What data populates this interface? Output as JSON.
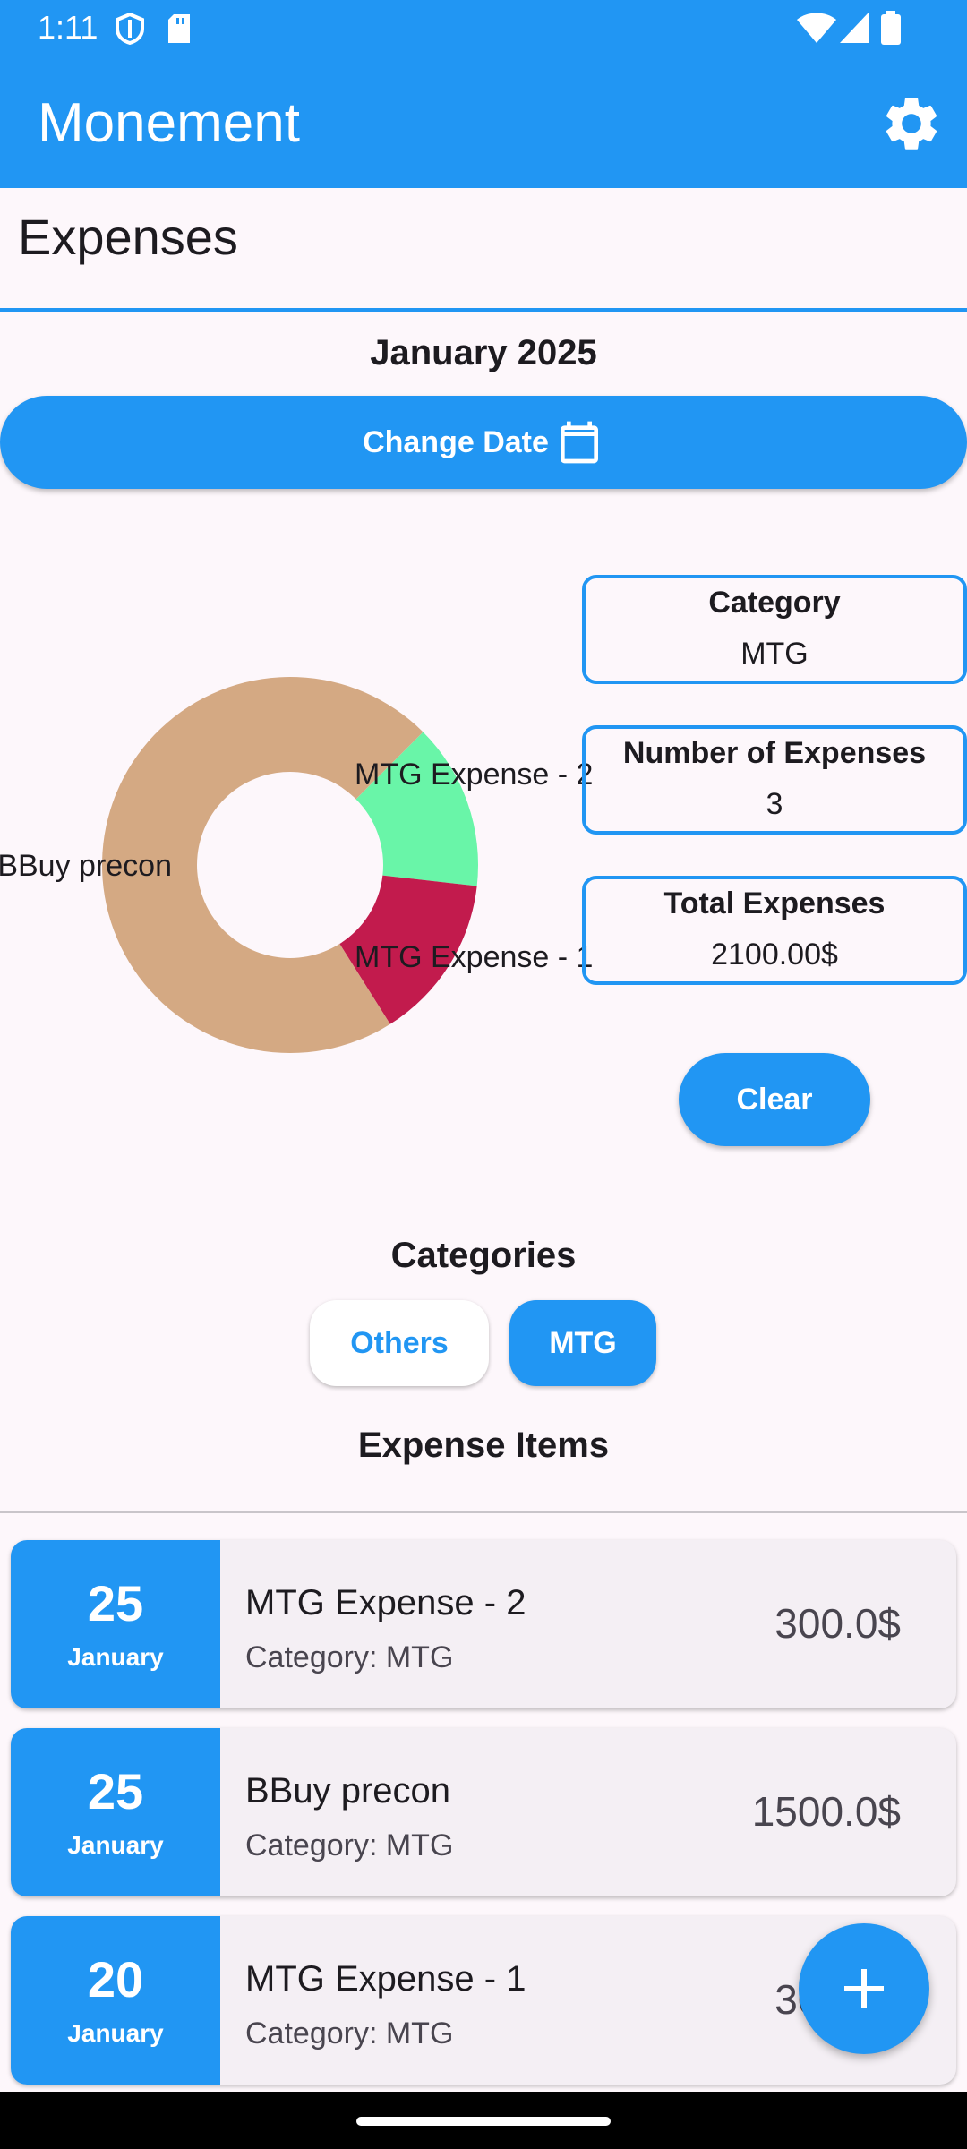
{
  "status_bar": {
    "time": "1:11"
  },
  "app_bar": {
    "title": "Monement"
  },
  "section": {
    "title": "Expenses"
  },
  "date_picker": {
    "month_label": "January 2025",
    "change_date_label": "Change Date"
  },
  "chart_data": {
    "type": "pie",
    "donut": true,
    "slices": [
      {
        "label": "MTG Expense - 2",
        "value": 300,
        "color": "#69f5a8"
      },
      {
        "label": "MTG Expense - 1",
        "value": 300,
        "color": "#c21b4d"
      },
      {
        "label": "BBuy precon",
        "value": 1500,
        "color": "#d4a983"
      }
    ]
  },
  "summary": {
    "category_label": "Category",
    "category_value": "MTG",
    "count_label": "Number of Expenses",
    "count_value": "3",
    "total_label": "Total Expenses",
    "total_value": "2100.00$",
    "clear_label": "Clear"
  },
  "categories": {
    "title": "Categories",
    "chips": [
      {
        "label": "Others",
        "selected": false
      },
      {
        "label": "MTG",
        "selected": true
      }
    ]
  },
  "expense_items": {
    "title": "Expense Items",
    "items": [
      {
        "day": "25",
        "month": "January",
        "name": "MTG Expense - 2",
        "category": "Category: MTG",
        "amount": "300.0$"
      },
      {
        "day": "25",
        "month": "January",
        "name": "BBuy precon",
        "category": "Category: MTG",
        "amount": "1500.0$"
      },
      {
        "day": "20",
        "month": "January",
        "name": "MTG Expense - 1",
        "category": "Category: MTG",
        "amount": "300.0$"
      }
    ]
  },
  "colors": {
    "primary": "#2196f3",
    "background": "#fdf7fb",
    "card": "#f4eff4"
  },
  "icons": {
    "settings": "gear-icon",
    "calendar": "calendar-icon",
    "add": "plus-icon"
  }
}
